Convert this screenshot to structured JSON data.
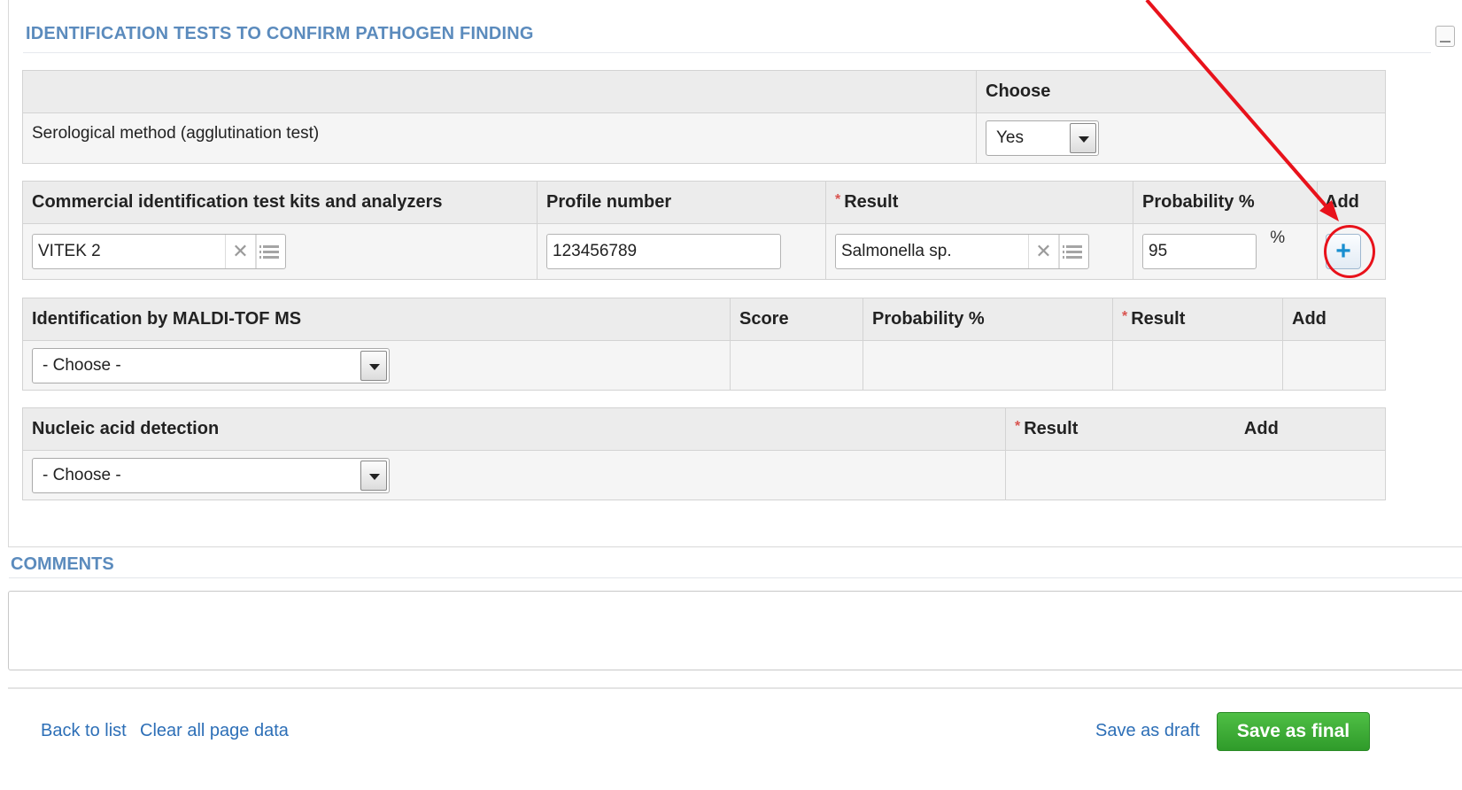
{
  "section": {
    "title": "IDENTIFICATION TESTS TO CONFIRM PATHOGEN FINDING"
  },
  "serological": {
    "choose_header": "Choose",
    "method_label": "Serological method (agglutination test)",
    "selected": "Yes"
  },
  "commercial": {
    "headers": {
      "kits": "Commercial identification test kits and analyzers",
      "profile": "Profile number",
      "result": "Result",
      "probability": "Probability %",
      "add": "Add"
    },
    "kit_value": "VITEK 2",
    "profile_value": "123456789",
    "result_value": "Salmonella sp.",
    "probability_value": "95",
    "percent_sign": "%"
  },
  "maldi": {
    "headers": {
      "method": "Identification by MALDI-TOF MS",
      "score": "Score",
      "probability": "Probability %",
      "result": "Result",
      "add": "Add"
    },
    "selected": "- Choose -"
  },
  "nucleic": {
    "headers": {
      "method": "Nucleic acid detection",
      "result": "Result",
      "add": "Add"
    },
    "selected": "- Choose -"
  },
  "required_mark": "*",
  "comments": {
    "title": "COMMENTS",
    "value": ""
  },
  "footer": {
    "back_to_list": "Back to list",
    "clear_all": "Clear all page data",
    "save_draft": "Save as draft",
    "save_final": "Save as final"
  },
  "icons": {
    "clear": "close-icon",
    "list": "list-icon",
    "add": "plus-icon",
    "dropdown": "chevron-down-icon"
  },
  "colors": {
    "title": "#5b8bbd",
    "link": "#2d6fb7",
    "save_final": "#3aa834",
    "annotation": "#e8121b",
    "add_plus": "#1a8fd0"
  }
}
